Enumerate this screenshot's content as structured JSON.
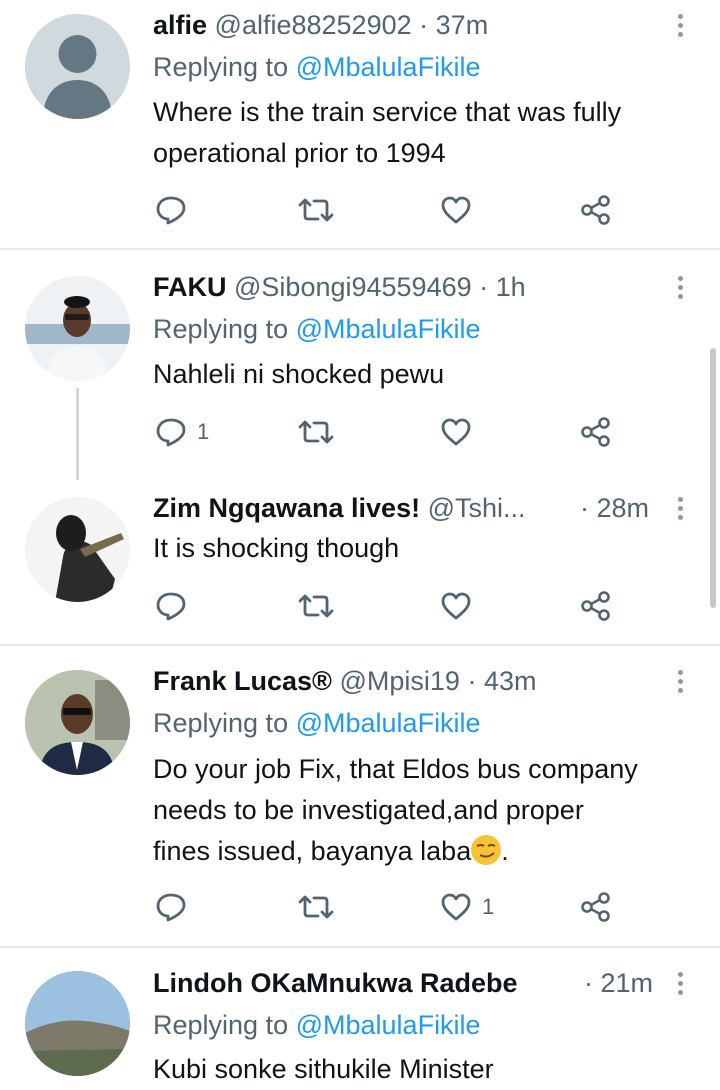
{
  "tweets": [
    {
      "name": "alfie",
      "handle": "@alfie88252902",
      "separator": "·",
      "time": "37m",
      "replying_prefix": "Replying to",
      "replying_to": "@MbalulaFikile",
      "text_lines": [
        "Where is the train service that was fully",
        "operational prior to 1994"
      ],
      "reply_count": "",
      "like_count": ""
    },
    {
      "name": "FAKU",
      "handle": "@Sibongi94559469",
      "separator": "·",
      "time": "1h",
      "replying_prefix": "Replying to",
      "replying_to": "@MbalulaFikile",
      "text_lines": [
        "Nahleli ni shocked pewu"
      ],
      "reply_count": "1",
      "like_count": ""
    },
    {
      "name": "Zim Ngqawana lives!",
      "handle": "@Tshi...",
      "separator": "·",
      "time": "28m",
      "text_lines": [
        "It is shocking though"
      ],
      "reply_count": "",
      "like_count": ""
    },
    {
      "name": "Frank Lucas®",
      "handle": "@Mpisi19",
      "separator": "·",
      "time": "43m",
      "replying_prefix": "Replying to",
      "replying_to": "@MbalulaFikile",
      "text_lines": [
        "Do your job Fix, that Eldos bus company",
        "needs to be investigated,and proper",
        "fines issued, bayanya laba"
      ],
      "text_suffix": ".",
      "emoji": "smirking-face",
      "reply_count": "",
      "like_count": "1"
    },
    {
      "name": "Lindoh OKaMnukwa Radebe",
      "handle": "",
      "separator": "·",
      "time": "21m",
      "replying_prefix": "Replying to",
      "replying_to": "@MbalulaFikile",
      "text_lines": [
        "Kubi sonke sithukile Minister"
      ],
      "reply_count": "",
      "like_count": ""
    }
  ],
  "colors": {
    "link": "#1d9bf0",
    "secondary_text": "#536471",
    "divider": "#e6e9eb",
    "text": "#0f1419"
  },
  "icons": [
    "reply-icon",
    "retweet-icon",
    "like-icon",
    "share-icon",
    "more-icon"
  ]
}
